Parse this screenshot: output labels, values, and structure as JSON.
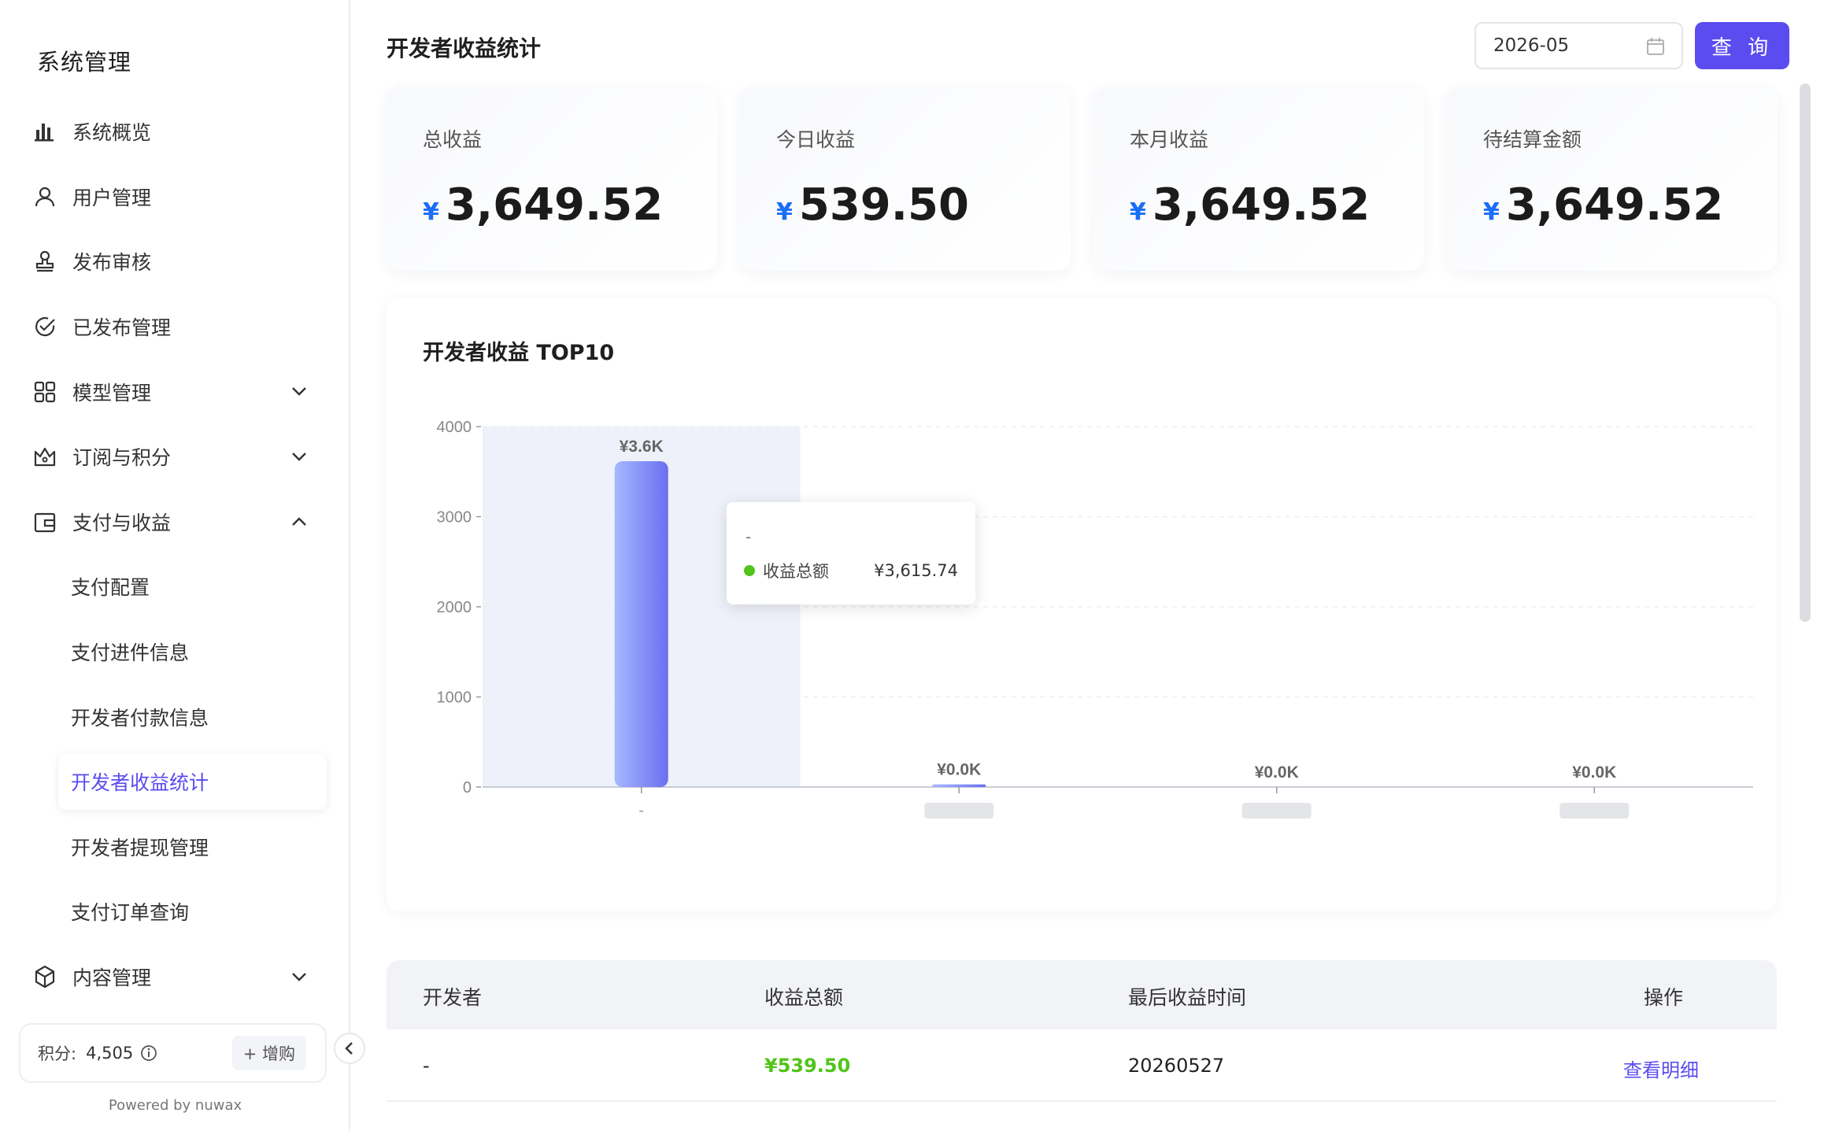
{
  "sidebar": {
    "title": "系统管理",
    "items": [
      {
        "label": "系统概览",
        "icon": "bar-chart-icon"
      },
      {
        "label": "用户管理",
        "icon": "user-icon"
      },
      {
        "label": "发布审核",
        "icon": "stamp-icon"
      },
      {
        "label": "已发布管理",
        "icon": "check-circle-icon"
      },
      {
        "label": "模型管理",
        "icon": "apps-icon"
      },
      {
        "label": "订阅与积分",
        "icon": "crown-icon"
      },
      {
        "label": "支付与收益",
        "icon": "wallet-icon"
      }
    ],
    "sub_items": [
      "支付配置",
      "支付进件信息",
      "开发者付款信息",
      "开发者收益统计",
      "开发者提现管理",
      "支付订单查询"
    ],
    "content_menu": "内容管理",
    "points_label": "积分:",
    "points_value": "4,505",
    "buy_label": "+ 增购",
    "powered_by": "Powered by nuwax"
  },
  "header": {
    "title": "开发者收益统计",
    "date_value": "2026-05",
    "query_label": "查 询"
  },
  "stats": [
    {
      "label": "总收益",
      "currency": "¥",
      "value": "3,649.52"
    },
    {
      "label": "今日收益",
      "currency": "¥",
      "value": "539.50"
    },
    {
      "label": "本月收益",
      "currency": "¥",
      "value": "3,649.52"
    },
    {
      "label": "待结算金额",
      "currency": "¥",
      "value": "3,649.52"
    }
  ],
  "chart_data": {
    "type": "bar",
    "title": "开发者收益 TOP10",
    "categories": [
      "-",
      "",
      "",
      ""
    ],
    "values": [
      3615.74,
      30,
      0,
      0
    ],
    "data_labels": [
      "¥3.6K",
      "¥0.0K",
      "¥0.0K",
      "¥0.0K"
    ],
    "yticks": [
      0,
      1000,
      2000,
      3000,
      4000
    ],
    "ylim": [
      0,
      4000
    ],
    "grid": true,
    "colors": {
      "bar_start": "#a6b8ff",
      "bar_end": "#6a6ff0",
      "highlight": "#eef1fa"
    }
  },
  "tooltip": {
    "title": "-",
    "series_name": "收益总额",
    "value": "¥3,615.74"
  },
  "table": {
    "headers": [
      "开发者",
      "收益总额",
      "最后收益时间",
      "操作"
    ],
    "rows": [
      {
        "developer": "-",
        "amount": "¥539.50",
        "last_time": "20260527",
        "action": "查看明细"
      }
    ]
  }
}
